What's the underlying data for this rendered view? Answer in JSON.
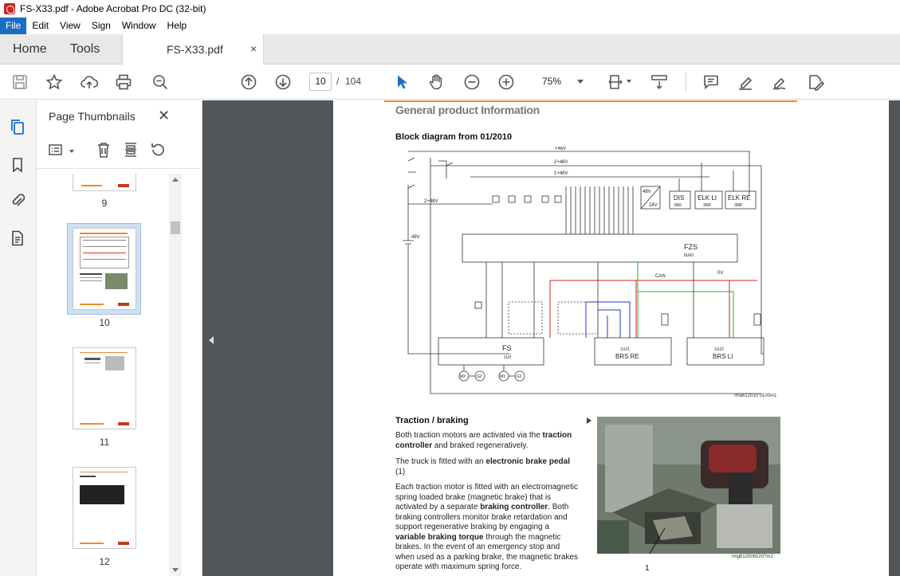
{
  "window": {
    "title": "FS-X33.pdf - Adobe Acrobat Pro DC (32-bit)"
  },
  "menu": [
    "File",
    "Edit",
    "View",
    "Sign",
    "Window",
    "Help"
  ],
  "tabs": {
    "home": "Home",
    "tools": "Tools",
    "document": "FS-X33.pdf",
    "close": "×"
  },
  "toolbar": {
    "page_current": "10",
    "page_separator": "/",
    "page_total": "104",
    "zoom": "75%"
  },
  "panel": {
    "title": "Page Thumbnails",
    "close": "✕",
    "thumbnails": [
      {
        "label": "9"
      },
      {
        "label": "10",
        "selected": true
      },
      {
        "label": "11"
      },
      {
        "label": "12"
      }
    ]
  },
  "document": {
    "section_title": "General product Information",
    "block_title": "Block diagram from 01/2010",
    "diagram_labels": {
      "v48": "+48V",
      "v48b": "2+48V",
      "v48c": "1+48V",
      "fzs": "FZS",
      "fzs_code": "8U60",
      "fs": "FS",
      "fs_code": "1U3",
      "brs_re": "BRS RE",
      "brs_re_code": "1U21",
      "brs_li": "BRS LI",
      "brs_li_code": "1U22",
      "dis": "DIS",
      "dis_code": "8A5",
      "elk_li": "ELK LI",
      "elk_li_code": "3M9",
      "elk_re": "ELK RE",
      "elk_re_code": "3M8",
      "can": "CAN",
      "zero_v": "0V",
      "battery": "48V",
      "m2": "M2",
      "g2": "G2",
      "m1": "M1",
      "g1": "G1",
      "conv_in": "48V",
      "conv_out": "24V"
    },
    "image_code": "Ima612010 0100m1",
    "traction_title": "Traction / braking",
    "para1_a": "Both traction motors are activated via the ",
    "para1_b": "traction controller",
    "para1_c": " and braked regeneratively.",
    "para2_a": "The truck is fitted with an ",
    "para2_b": "electronic brake pedal",
    "para2_c": " (1)",
    "para3_a": "Each traction motor is fitted with an electromagnetic spring loaded brake (magnetic brake) that is activated by a separate ",
    "para3_b": "braking controller",
    "para3_c": ". Both braking controllers monitor brake retardation and support regenerative braking by engaging a ",
    "para3_d": "variable braking torque",
    "para3_e": " through the magnetic brakes. In the event of an emergency stop and when used as a parking brake, the magnetic brakes operate with maximum spring force.",
    "photo_code": "Img6120060207m2",
    "photo_callout": "1"
  },
  "colors": {
    "accent_blue": "#1a6fc4",
    "orange_rule": "#f08a2c",
    "doc_background": "#525659",
    "can_line": "#d62020",
    "signal_blue": "#2038c8",
    "signal_green": "#22b030"
  },
  "icons": {
    "save": "save-icon",
    "bookmark": "star-icon",
    "upload": "upload-cloud-icon",
    "print": "printer-icon",
    "search": "zoom-search-icon",
    "prev": "arrow-up-circle-icon",
    "next": "arrow-down-circle-icon",
    "select": "cursor-arrow-icon",
    "hand": "hand-icon",
    "zoom_out": "minus-circle-icon",
    "zoom_in": "plus-circle-icon",
    "comment": "comment-icon",
    "highlight": "highlighter-icon",
    "sign": "pen-sign-icon",
    "edit": "edit-doc-icon"
  }
}
